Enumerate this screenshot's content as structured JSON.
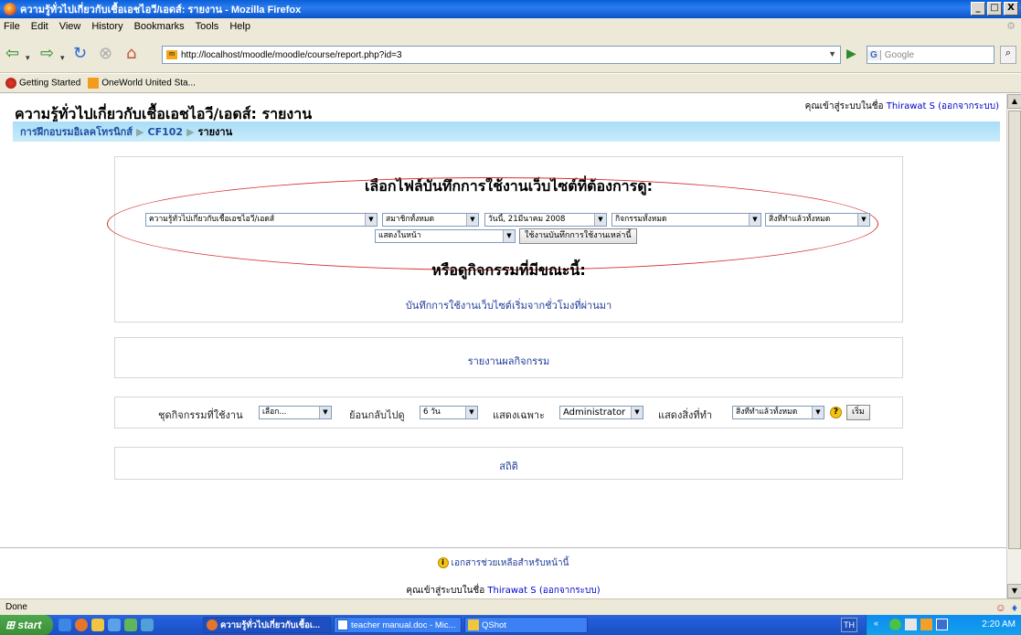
{
  "window": {
    "title": "ความรู้ทั่วไปเกี่ยวกับเชื้อเอชไอวี/เอดส์: รายงาน - Mozilla Firefox",
    "buttons": [
      "_",
      "□",
      "X"
    ]
  },
  "menu": [
    "File",
    "Edit",
    "View",
    "History",
    "Bookmarks",
    "Tools",
    "Help"
  ],
  "nav": {
    "url": "http://localhost/moodle/moodle/course/report.php?id=3",
    "search_placeholder": "Google",
    "search_engine_label": "G"
  },
  "bookmarks": [
    "Getting Started",
    "OneWorld United Sta..."
  ],
  "page": {
    "title": "ความรู้ทั่วไปเกี่ยวกับเชื้อเอชไอวี/เอดส์: รายงาน",
    "login_prefix": "คุณเข้าสู่ระบบในชื่อ",
    "login_user": "Thirawat S",
    "login_logout": "(ออกจากระบบ)",
    "breadcrumb": [
      "การฝึกอบรมอิเลคโทรนิกส์",
      "CF102",
      "รายงาน"
    ],
    "logs_heading": "เลือกไฟล์บันทึกการใช้งานเว็บไซต์ที่ต้องการดู:",
    "log_filters": {
      "course": "ความรู้ทั่วไปเกี่ยวกับเชื้อเอชไอวี/เอดส์",
      "members": "สมาชิกทั้งหมด",
      "date": "วันนี้, 21มีนาคม 2008",
      "activities": "กิจกรรมทั้งหมด",
      "actions": "สิ่งที่ทำแล้วทั้งหมด",
      "display": "แสดงในหน้า",
      "submit": "ใช้งานบันทึกการใช้งานเหล่านี้"
    },
    "or_heading": "หรือดูกิจกรรมที่มีขณะนี้:",
    "live_logs_link": "บันทึกการใช้งานเว็บไซต์เริ่มจากชั่วโมงที่ผ่านมา",
    "activity_report_link": "รายงานผลกิจกรรม",
    "participation": {
      "activity_label": "ชุดกิจกรรมที่ใช้งาน",
      "activity_value": "เลือก...",
      "lookback_label": "ย้อนกลับไปดู",
      "lookback_value": "6 วัน",
      "show_only_label": "แสดงเฉพาะ",
      "show_only_value": "Administrator",
      "show_actions_label": "แสดงสิ่งที่ทำ",
      "show_actions_value": "สิ่งที่ทำแล้วทั้งหมด",
      "go_button": "เริ่ม",
      "help_glyph": "?"
    },
    "stats_link": "สถิติ",
    "footer_help": "เอกสารช่วยเหลือสำหรับหน้านี้",
    "footer_help_glyph": "i"
  },
  "status": "Done",
  "taskbar": {
    "start": "start",
    "tasks": [
      "ความรู้ทั่วไปเกี่ยวกับเชื้อเ...",
      "teacher manual.doc - Mic...",
      "QShot"
    ],
    "lang": "TH",
    "clock": "2:20 AM"
  },
  "colors": {
    "titlebar": "#0a5fd8",
    "breadcrumb_bg": "#b5e2f8",
    "link": "#1f3d99",
    "oval": "#d63030"
  }
}
